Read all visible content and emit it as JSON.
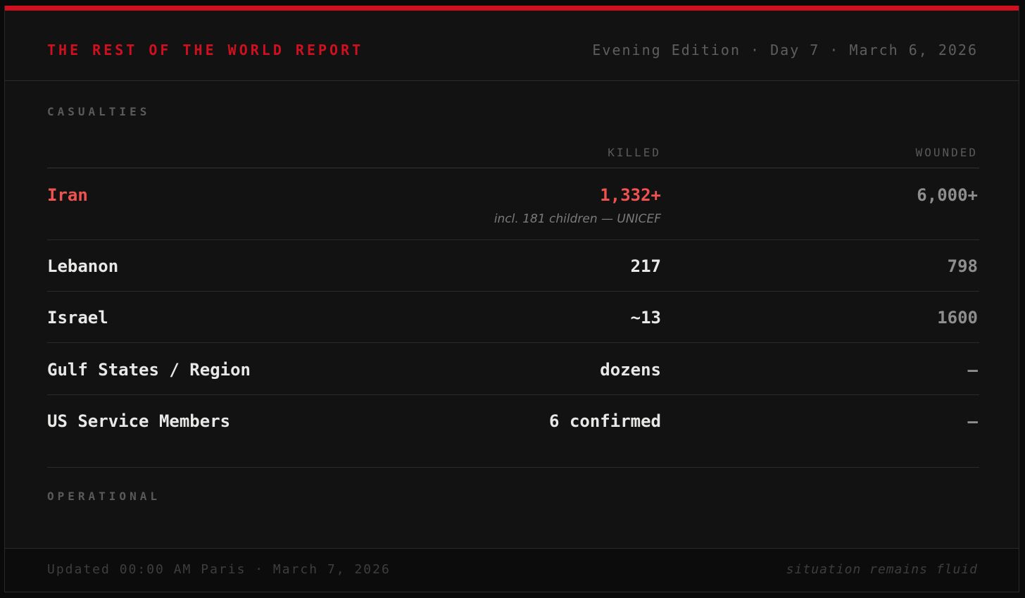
{
  "header": {
    "brand": "THE REST OF THE WORLD REPORT",
    "edition": "Evening Edition · Day 7 · March 6, 2026"
  },
  "colors": {
    "accent_red": "#d0101e",
    "highlight_red": "#ef5350",
    "background": "#121213"
  },
  "casualties": {
    "section_label": "CASUALTIES",
    "columns": {
      "killed": "KILLED",
      "wounded": "WOUNDED"
    },
    "rows": [
      {
        "country": "Iran",
        "killed": "1,332+",
        "killed_note": "incl. 181 children — UNICEF",
        "wounded": "6,000+",
        "highlighted": true
      },
      {
        "country": "Lebanon",
        "killed": "217",
        "wounded": "798"
      },
      {
        "country": "Israel",
        "killed": "~13",
        "wounded": "1600"
      },
      {
        "country": "Gulf States / Region",
        "killed": "dozens",
        "wounded": "—"
      },
      {
        "country": "US Service Members",
        "killed": "6 confirmed",
        "wounded": "—"
      }
    ]
  },
  "operational": {
    "section_label": "OPERATIONAL"
  },
  "footer": {
    "updated": "Updated 00:00 AM Paris · March 7, 2026",
    "status": "situation remains fluid"
  }
}
